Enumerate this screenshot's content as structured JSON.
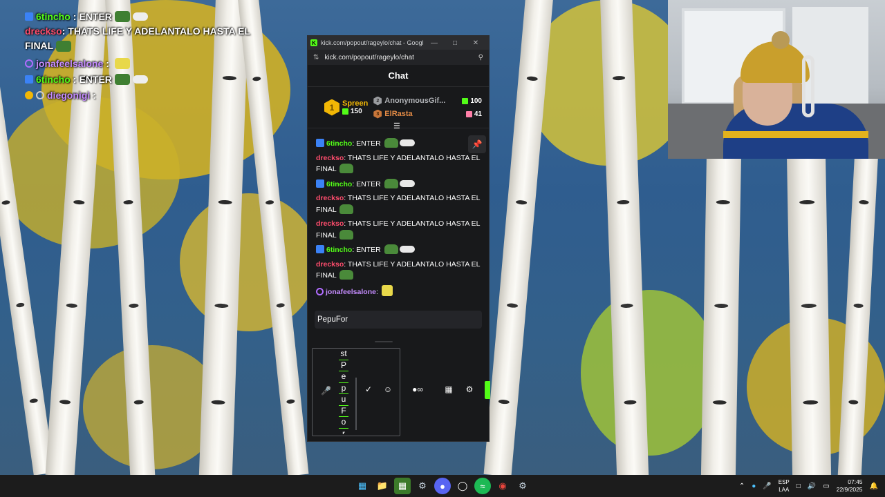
{
  "overlay_chat": [
    {
      "user": "6tincho",
      "text": "ENTER"
    },
    {
      "user": "dreckso",
      "text": "THATS LIFE Y ADELANTALO HASTA EL FINAL"
    },
    {
      "user": "jonafeelsalone",
      "text": ""
    },
    {
      "user": "6tincho",
      "text": "ENTER"
    },
    {
      "user": "diegonigi",
      "text": ""
    }
  ],
  "window": {
    "title": "kick.com/popout/rageylo/chat - Google C...",
    "url": "kick.com/popout/rageylo/chat"
  },
  "chat": {
    "header": "Chat",
    "leaderboard": {
      "first": {
        "rank": "1",
        "name": "Spreen",
        "count": "150"
      },
      "second": {
        "rank": "2",
        "name": "AnonymousGif...",
        "count": "100"
      },
      "third": {
        "rank": "3",
        "name": "ElRasta",
        "count": "41"
      }
    },
    "messages": [
      {
        "user": "6tincho",
        "text": " ENTER "
      },
      {
        "user": "dreckso",
        "text": " THATS LIFE Y ADELANTALO HASTA EL FINAL "
      },
      {
        "user": "6tincho",
        "text": " ENTER "
      },
      {
        "user": "dreckso",
        "text": " THATS LIFE Y ADELANTALO HASTA EL FINAL "
      },
      {
        "user": "dreckso",
        "text": " THATS LIFE Y ADELANTALO HASTA EL FINAL "
      },
      {
        "user": "6tincho",
        "text": " ENTER "
      },
      {
        "user": "dreckso",
        "text": " THATS LIFE Y ADELANTALO HASTA EL FINAL "
      },
      {
        "user": "jonafeelsalone",
        "text": " "
      }
    ],
    "input_value": "PepuFor",
    "vertical_letters": [
      "st",
      "P",
      "e",
      "p",
      "u",
      "F",
      "o",
      "r"
    ]
  },
  "tray": {
    "lang_top": "ESP",
    "lang_bottom": "LAA",
    "time": "07:45",
    "date": "22/9/2025"
  }
}
